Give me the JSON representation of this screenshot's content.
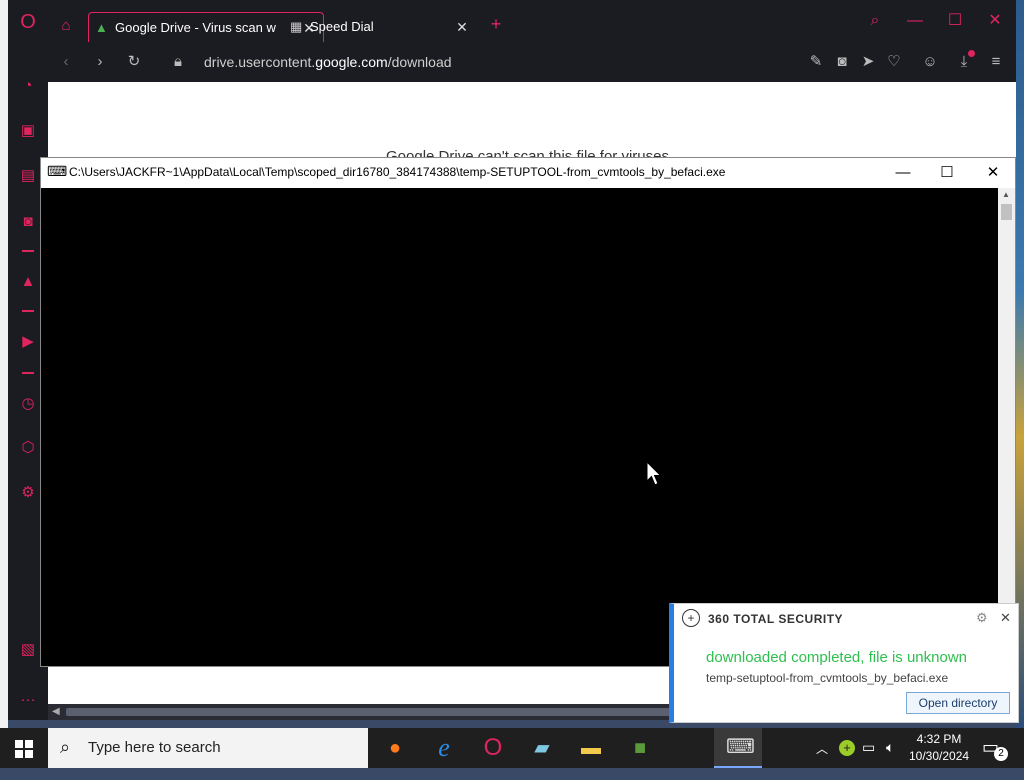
{
  "browser": {
    "tabs": [
      {
        "label": "Google Drive - Virus scan w",
        "icon": "google-drive-icon",
        "active": true
      },
      {
        "label": "Speed Dial",
        "icon": "grid-icon",
        "active": false
      }
    ],
    "url_prefix": "drive.usercontent.",
    "url_domain": "google.com",
    "url_suffix": "/download",
    "page_text": "Google Drive can't scan this file for viruses.",
    "accent_color": "#e0245e"
  },
  "console": {
    "title": "C:\\Users\\JACKFR~1\\AppData\\Local\\Temp\\scoped_dir16780_384174388\\temp-SETUPTOOL-from_cvmtools_by_befaci.exe",
    "minimize": "—",
    "maximize": "☐",
    "close": "✕"
  },
  "notification": {
    "brand": "360 TOTAL SECURITY",
    "message": "downloaded completed, file is unknown",
    "filename": "temp-setuptool-from_cvmtools_by_befaci.exe",
    "button": "Open directory",
    "message_color": "#2fbf4f"
  },
  "taskbar": {
    "search_placeholder": "Type here to search",
    "time": "4:32 PM",
    "date": "10/30/2024",
    "notification_count": "2"
  }
}
